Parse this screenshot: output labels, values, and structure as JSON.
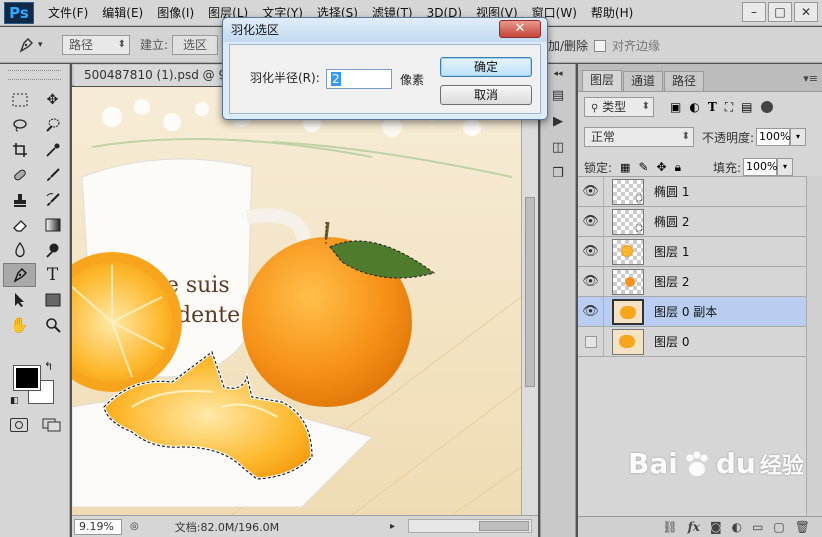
{
  "app": {
    "logo": "Ps",
    "menu": [
      "文件(F)",
      "编辑(E)",
      "图像(I)",
      "图层(L)",
      "文字(Y)",
      "选择(S)",
      "滤镜(T)",
      "3D(D)",
      "视图(V)",
      "窗口(W)",
      "帮助(H)"
    ],
    "window_controls": [
      "–",
      "□",
      "✕"
    ]
  },
  "options_bar": {
    "mode_select": "路径",
    "make_label": "建立:",
    "selection_button": "选区",
    "right_text": "加/删除",
    "align_edges_label": "对齐边缘"
  },
  "toolbar": {
    "tools": [
      "rect-marquee",
      "move",
      "lasso",
      "quick-select",
      "crop",
      "eyedropper",
      "healing",
      "brush",
      "clone-stamp",
      "history-brush",
      "eraser",
      "gradient",
      "blur",
      "dodge",
      "pen",
      "type",
      "path-select",
      "shape",
      "hand",
      "zoom"
    ],
    "foreground_color": "#000000",
    "background_color": "#ffffff"
  },
  "document": {
    "tab_title": "500487810 (1).psd @ 9.19",
    "zoom": "9.19%",
    "doc_info": "文档:82.0M/196.0M",
    "canvas_text_line1": "Je suis",
    "canvas_text_line2": "dente"
  },
  "dialog": {
    "title": "羽化选区",
    "close": "✕",
    "radius_label": "羽化半径(R):",
    "radius_value": "2",
    "unit": "像素",
    "ok": "确定",
    "cancel": "取消"
  },
  "layers_panel": {
    "tabs": [
      "图层",
      "通道",
      "路径"
    ],
    "filter_kind": "类型",
    "blend_mode": "正常",
    "opacity_label": "不透明度:",
    "opacity_value": "100%",
    "lock_label": "锁定:",
    "fill_label": "填充:",
    "fill_value": "100%",
    "layers": [
      {
        "name": "椭圆 1",
        "visible": true,
        "selected": false
      },
      {
        "name": "椭圆 2",
        "visible": true,
        "selected": false
      },
      {
        "name": "图层 1",
        "visible": true,
        "selected": false
      },
      {
        "name": "图层 2",
        "visible": true,
        "selected": false
      },
      {
        "name": "图层 0 副本",
        "visible": true,
        "selected": true
      },
      {
        "name": "图层 0",
        "visible": false,
        "selected": false
      }
    ]
  },
  "watermark": {
    "brand": "Bai",
    "brand2": "du",
    "sub": "经验"
  }
}
